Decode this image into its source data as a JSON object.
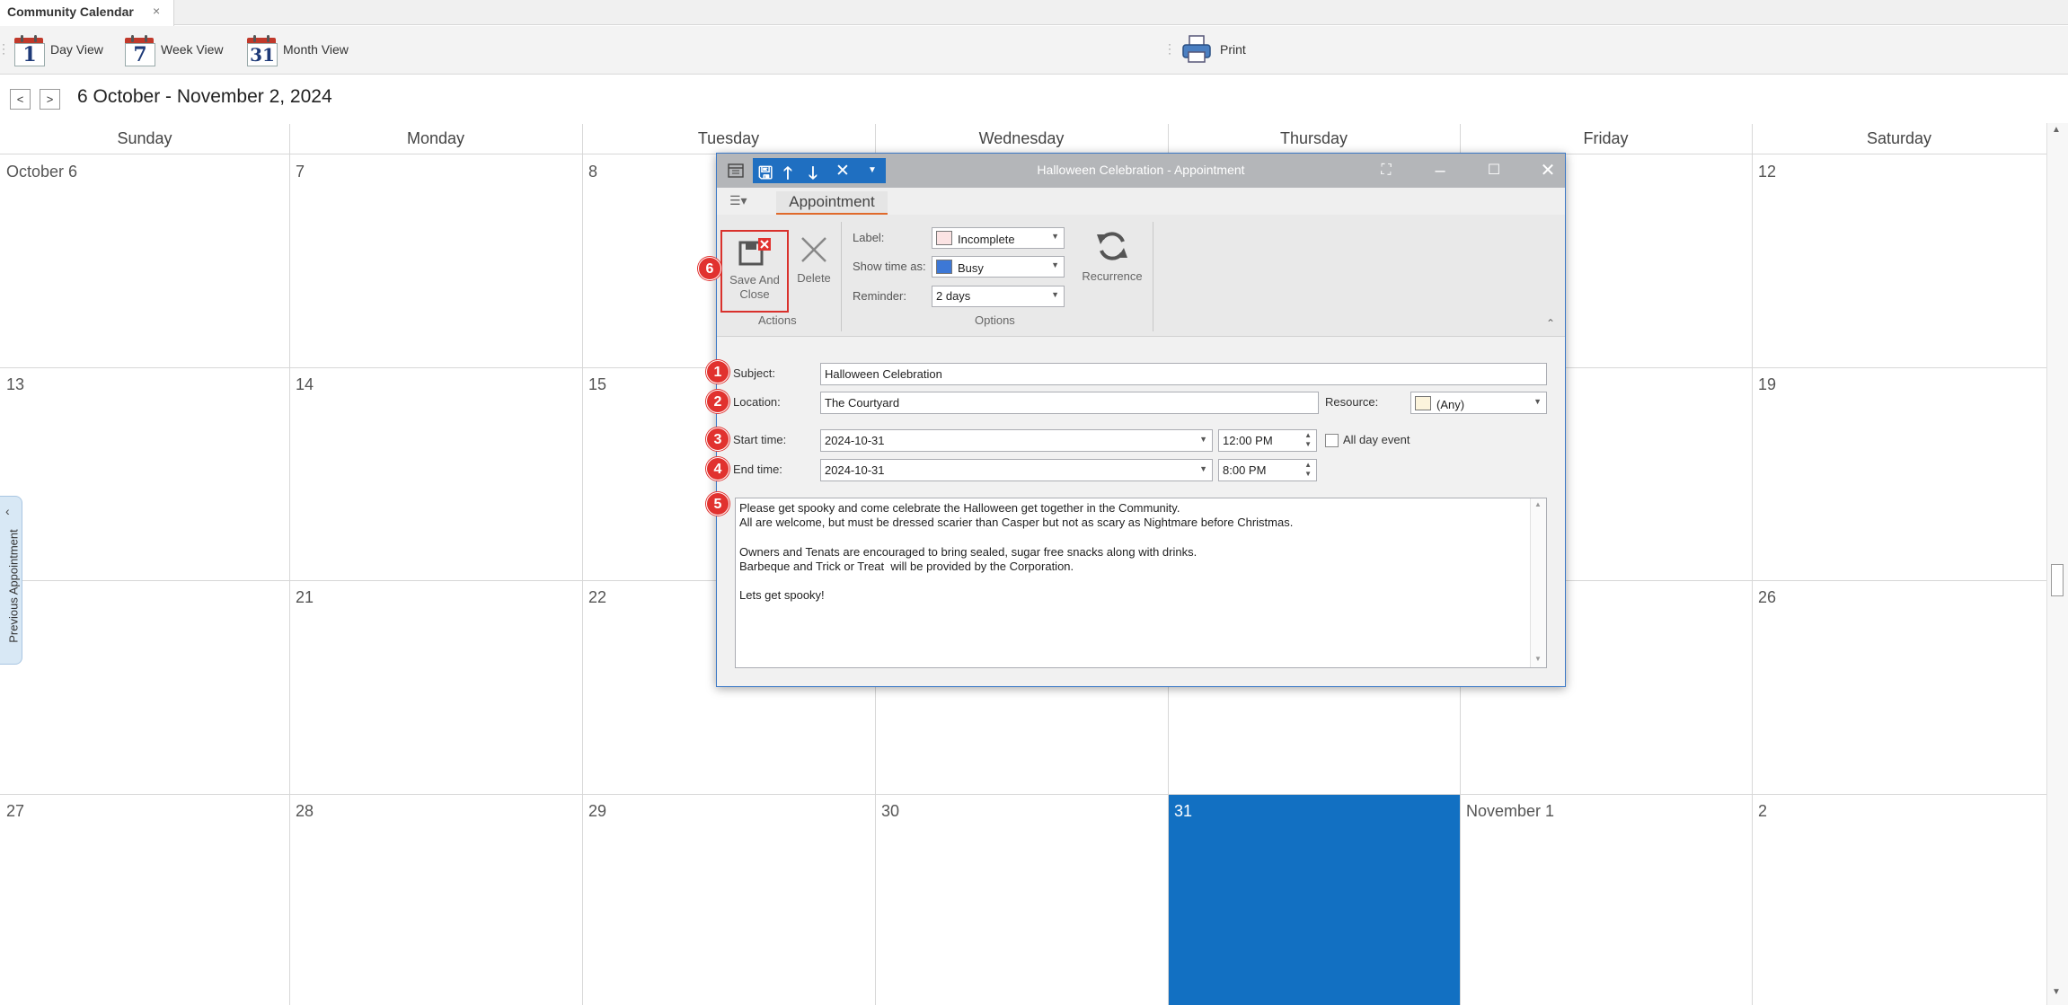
{
  "tab": {
    "title": "Community Calendar",
    "close": "×"
  },
  "toolbar": {
    "day_view": {
      "label": "Day View",
      "icon": "calendar-day-icon",
      "number": "1"
    },
    "week_view": {
      "label": "Week View",
      "icon": "calendar-week-icon",
      "number": "7"
    },
    "month_view": {
      "label": "Month View",
      "icon": "calendar-month-icon",
      "number": "31"
    },
    "print": {
      "label": "Print",
      "icon": "printer-icon"
    }
  },
  "nav": {
    "prev": "<",
    "next": ">",
    "range": "6 October - November 2, 2024"
  },
  "calendar": {
    "days": [
      "Sunday",
      "Monday",
      "Tuesday",
      "Wednesday",
      "Thursday",
      "Friday",
      "Saturday"
    ],
    "weeks": [
      [
        "October 6",
        "7",
        "8",
        "",
        "",
        "",
        "12"
      ],
      [
        "13",
        "14",
        "15",
        "",
        "",
        "",
        "19"
      ],
      [
        "",
        "21",
        "22",
        "",
        "",
        "",
        "26"
      ],
      [
        "27",
        "28",
        "29",
        "30",
        "31",
        "November 1",
        "2"
      ]
    ],
    "today_color": "#1270c2"
  },
  "prev_appointment": "Previous Appointment",
  "dialog": {
    "title": "Halloween Celebration - Appointment",
    "ribbon_tab": "Appointment",
    "actions": {
      "save_and_close": "Save And Close",
      "save_line1": "Save And",
      "save_line2": "Close",
      "delete": "Delete",
      "group": "Actions"
    },
    "options": {
      "label_label": "Label:",
      "label_value": "Incomplete",
      "label_color": "#fbe3e3",
      "show_time_label": "Show time as:",
      "show_time_value": "Busy",
      "show_time_color": "#3d78d6",
      "reminder_label": "Reminder:",
      "reminder_value": "2 days",
      "recurrence": "Recurrence",
      "group": "Options"
    },
    "form": {
      "subject_label": "Subject:",
      "subject_value": "Halloween Celebration",
      "location_label": "Location:",
      "location_value": "The Courtyard",
      "resource_label": "Resource:",
      "resource_value": "(Any)",
      "start_label": "Start time:",
      "start_date": "2024-10-31",
      "start_time": "12:00 PM",
      "all_day": "All day event",
      "end_label": "End time:",
      "end_date": "2024-10-31",
      "end_time": "8:00 PM",
      "notes": [
        "Please get spooky and come celebrate the Halloween get together in the Community.",
        "All are welcome, but must be dressed scarier than Casper but not as scary as Nightmare before Christmas.",
        "",
        "Owners and Tenats are encouraged to bring sealed, sugar free snacks along with drinks.",
        "Barbeque and Trick or Treat  will be provided by the Corporation.",
        "",
        "Lets get spooky!"
      ]
    },
    "badges": [
      "1",
      "2",
      "3",
      "4",
      "5",
      "6"
    ]
  }
}
